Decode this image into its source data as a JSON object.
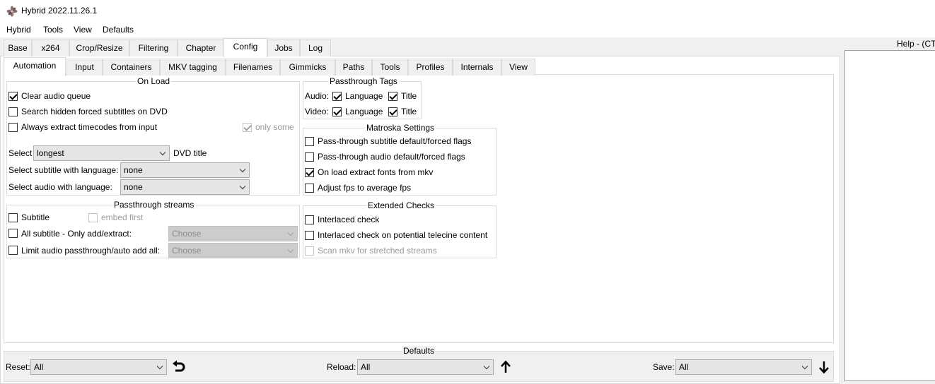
{
  "window": {
    "title": "Hybrid 2022.11.26.1",
    "icon": "flower-icon"
  },
  "menu": [
    "Hybrid",
    "Tools",
    "View",
    "Defaults"
  ],
  "main_tabs": [
    "Base",
    "x264",
    "Crop/Resize",
    "Filtering",
    "Chapter",
    "Config",
    "Jobs",
    "Log"
  ],
  "main_tab_active": "Config",
  "sub_tabs": [
    "Automation",
    "Input",
    "Containers",
    "MKV tagging",
    "Filenames",
    "Gimmicks",
    "Paths",
    "Tools",
    "Profiles",
    "Internals",
    "View"
  ],
  "sub_tab_active": "Automation",
  "on_load": {
    "title": "On Load",
    "clear_audio_queue": {
      "label": "Clear audio queue",
      "checked": true
    },
    "search_hidden_forced": {
      "label": "Search hidden forced subtitles on DVD",
      "checked": false
    },
    "always_extract_timecodes": {
      "label": "Always extract timecodes from input",
      "checked": false
    },
    "only_some": {
      "label": "only some",
      "checked": true,
      "enabled": false
    },
    "select_label": "Select",
    "select_value": "longest",
    "dvd_title_label": "DVD title",
    "subtitle_lang_label": "Select subtitle with language:",
    "subtitle_lang_value": "none",
    "audio_lang_label": "Select audio with language:",
    "audio_lang_value": "none"
  },
  "passthrough_streams": {
    "title": "Passthrough streams",
    "subtitle": {
      "label": "Subtitle",
      "checked": false
    },
    "embed_first": {
      "label": "embed first",
      "checked": false,
      "enabled": false
    },
    "all_subtitle": {
      "label": "All subtitle - Only add/extract:",
      "checked": false
    },
    "all_subtitle_value": "Choose",
    "limit_audio": {
      "label": "Limit audio passthrough/auto add all:",
      "checked": false
    },
    "limit_audio_value": "Choose"
  },
  "passthrough_tags": {
    "title": "Passthrough Tags",
    "audio_label": "Audio:",
    "video_label": "Video:",
    "language_label": "Language",
    "title_label": "Title",
    "audio_language": true,
    "audio_title": true,
    "video_language": true,
    "video_title": true
  },
  "matroska": {
    "title": "Matroska Settings",
    "items": [
      {
        "label": "Pass-through subtitle default/forced flags",
        "checked": false
      },
      {
        "label": "Pass-through audio default/forced flags",
        "checked": false
      },
      {
        "label": "On load extract fonts from mkv",
        "checked": true
      },
      {
        "label": "Adjust fps to average fps",
        "checked": false
      }
    ]
  },
  "extended_checks": {
    "title": "Extended Checks",
    "items": [
      {
        "label": "Interlaced check",
        "checked": false,
        "enabled": true
      },
      {
        "label": "Interlaced check on potential telecine content",
        "checked": false,
        "enabled": true
      },
      {
        "label": "Scan mkv for stretched  streams",
        "checked": false,
        "enabled": false
      }
    ]
  },
  "help": {
    "title": "Help - (CT"
  },
  "defaults": {
    "title": "Defaults",
    "reset_label": "Reset:",
    "reset_value": "All",
    "reload_label": "Reload:",
    "reload_value": "All",
    "save_label": "Save:",
    "save_value": "All"
  }
}
